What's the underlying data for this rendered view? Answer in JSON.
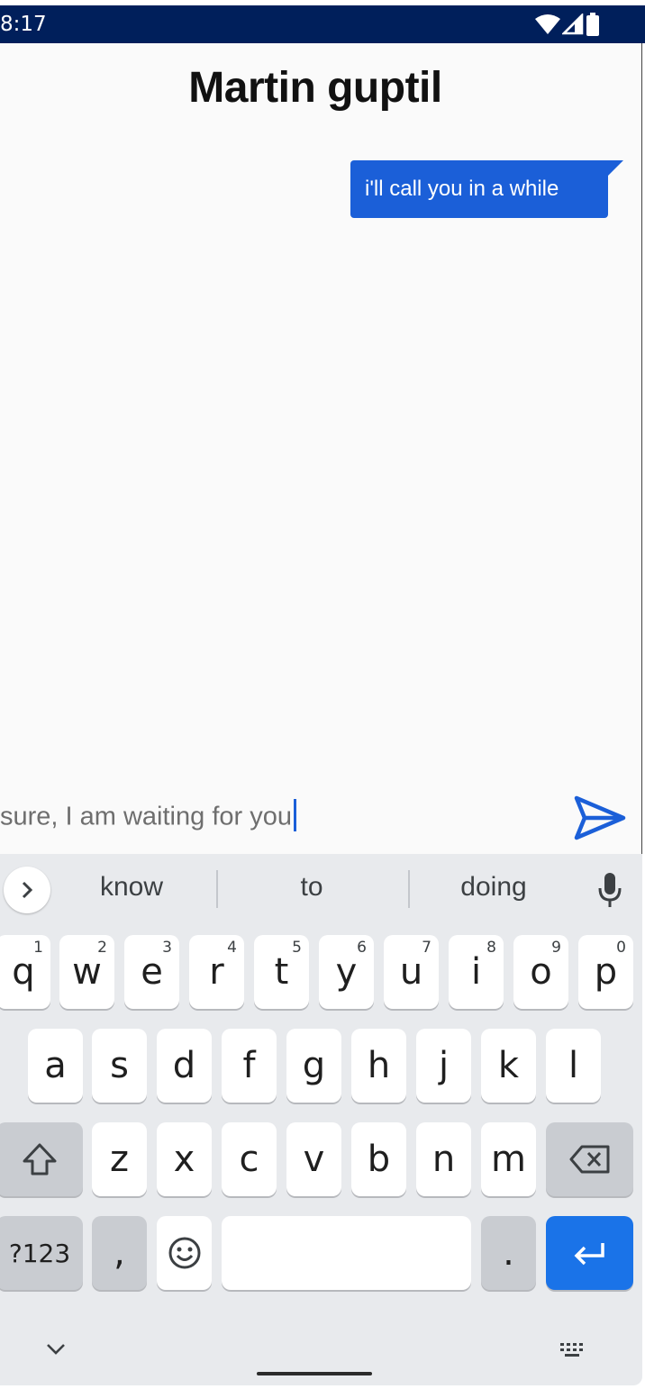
{
  "status_bar": {
    "time": "8:17"
  },
  "chat": {
    "title": "Martin guptil",
    "messages": [
      {
        "text": "i'll call you in a while"
      }
    ],
    "compose_text": "sure, I am waiting for you"
  },
  "keyboard": {
    "suggestions": [
      "know",
      "to",
      "doing"
    ],
    "rows": {
      "row1": [
        {
          "label": "q",
          "hint": "1"
        },
        {
          "label": "w",
          "hint": "2"
        },
        {
          "label": "e",
          "hint": "3"
        },
        {
          "label": "r",
          "hint": "4"
        },
        {
          "label": "t",
          "hint": "5"
        },
        {
          "label": "y",
          "hint": "6"
        },
        {
          "label": "u",
          "hint": "7"
        },
        {
          "label": "i",
          "hint": "8"
        },
        {
          "label": "o",
          "hint": "9"
        },
        {
          "label": "p",
          "hint": "0"
        }
      ],
      "row2": [
        "a",
        "s",
        "d",
        "f",
        "g",
        "h",
        "j",
        "k",
        "l"
      ],
      "row3": [
        "z",
        "x",
        "c",
        "v",
        "b",
        "n",
        "m"
      ]
    },
    "symbols_label": "?123",
    "comma_label": ",",
    "period_label": "."
  },
  "colors": {
    "status_bar": "#001f5b",
    "accent": "#1b5fd8",
    "enter_key": "#1a73e8",
    "keyboard_bg": "#e8eaed"
  },
  "icons": [
    "wifi-icon",
    "signal-icon",
    "battery-icon",
    "send-icon",
    "chevron-right-icon",
    "mic-icon",
    "shift-icon",
    "backspace-icon",
    "emoji-icon",
    "enter-icon",
    "chevron-down-icon",
    "keyboard-icon"
  ]
}
